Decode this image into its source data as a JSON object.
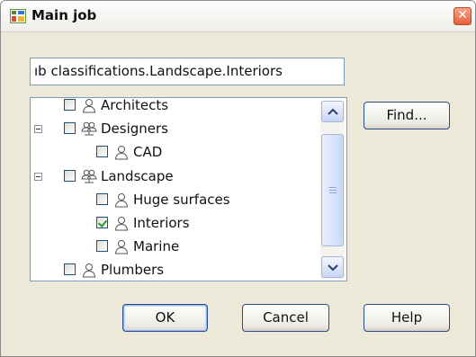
{
  "window": {
    "title": "Main job"
  },
  "path_field": {
    "value": "ıb classifications.Landscape.Interiors"
  },
  "tree": {
    "items": [
      {
        "label": "Architects",
        "checked": false,
        "expander": false,
        "icon": "person-icon"
      },
      {
        "label": "Designers",
        "checked": false,
        "expander": true,
        "icon": "group-icon"
      },
      {
        "label": "CAD",
        "checked": false,
        "expander": false,
        "icon": "person-icon"
      },
      {
        "label": "Landscape",
        "checked": false,
        "expander": true,
        "icon": "group-icon"
      },
      {
        "label": "Huge surfaces",
        "checked": false,
        "expander": false,
        "icon": "person-icon"
      },
      {
        "label": "Interiors",
        "checked": true,
        "expander": false,
        "icon": "person-icon"
      },
      {
        "label": "Marine",
        "checked": false,
        "expander": false,
        "icon": "person-icon"
      },
      {
        "label": "Plumbers",
        "checked": false,
        "expander": false,
        "icon": "person-icon"
      }
    ]
  },
  "buttons": {
    "find": "Find...",
    "ok": "OK",
    "cancel": "Cancel",
    "help": "Help"
  },
  "colors": {
    "dialog_bg": "#ece9d8",
    "close_button": "#e4603e",
    "button_border": "#2c4d8a",
    "field_border": "#7f9db9"
  }
}
